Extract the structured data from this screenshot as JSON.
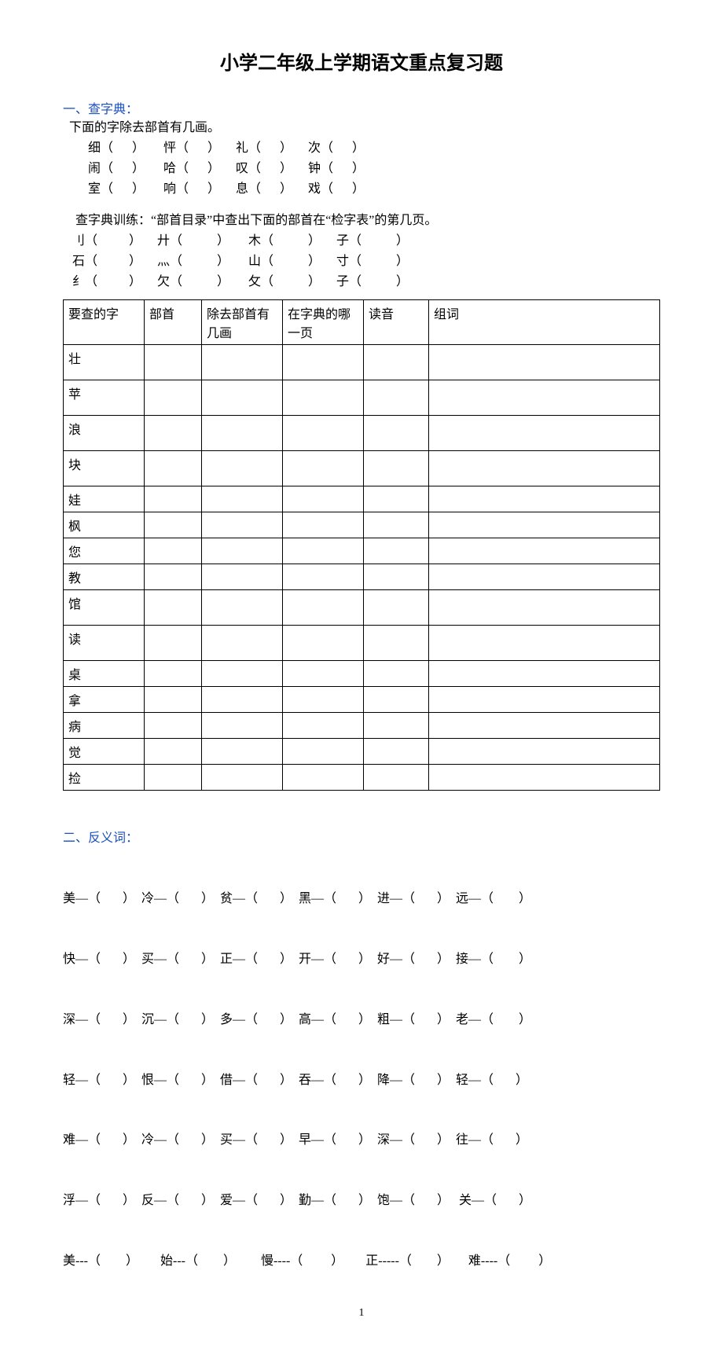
{
  "title": "小学二年级上学期语文重点复习题",
  "s1": {
    "heading": "一、查字典：",
    "sub1": "  下面的字除去部首有几画。",
    "row1": "细（      ）      怦（      ）     礼（      ）     次（      ）",
    "row2": "闹（      ）      哈（      ）     叹（      ）     钟（      ）",
    "row3": "室（      ）      响（      ）     息（      ）     戏（      ）",
    "sub2": "    查字典训练：“部首目录”中查出下面的部首在“检字表”的第几页。",
    "rad1": "   刂（          ）     廾（           ）      木（           ）     子（           ）",
    "rad2": "   石（          ）     灬（           ）      山（           ）     寸（           ）",
    "rad3": "   纟（          ）     欠（           ）      攵（           ）     子（           ）"
  },
  "table": {
    "h1": "要查的字",
    "h2": "部首",
    "h3": "除去部首有几画",
    "h4": "在字典的哪一页",
    "h5": "读音",
    "h6": "组词",
    "chars": [
      "壮",
      "苹",
      "浪",
      "块",
      "娃",
      "枫",
      "您",
      "教",
      "馆",
      "读",
      "桌",
      "拿",
      "病",
      "觉",
      "捡"
    ]
  },
  "s2": {
    "heading": "二、反义词：",
    "l1": "美—（       ）  冷—（       ）  贫—（       ）  黑—（       ）  进—（       ）  远—（        ）",
    "l2": "快—（       ）  买—（       ）  正—（       ）  开—（       ）  好—（       ）  接—（        ）",
    "l3": "深—（       ）  沉—（       ）  多—（       ）  高—（       ）  粗—（       ）  老—（        ）",
    "l4": "轻—（       ）  恨—（       ）  借—（       ）  吞—（       ）  降—（       ）  轻—（       ）",
    "l5": "难—（       ）  冷—（       ）  买—（       ）  早—（       ）  深—（       ）  往—（       ）",
    "l6": "浮—（       ）  反—（       ）  爱—（       ）  勤—（       ）  饱—（       ）   关—（       ）",
    "l7": "美---（        ）       始---（        ）        慢----（         ）       正-----（        ）      难----（         ）"
  },
  "pageNumber": "1"
}
